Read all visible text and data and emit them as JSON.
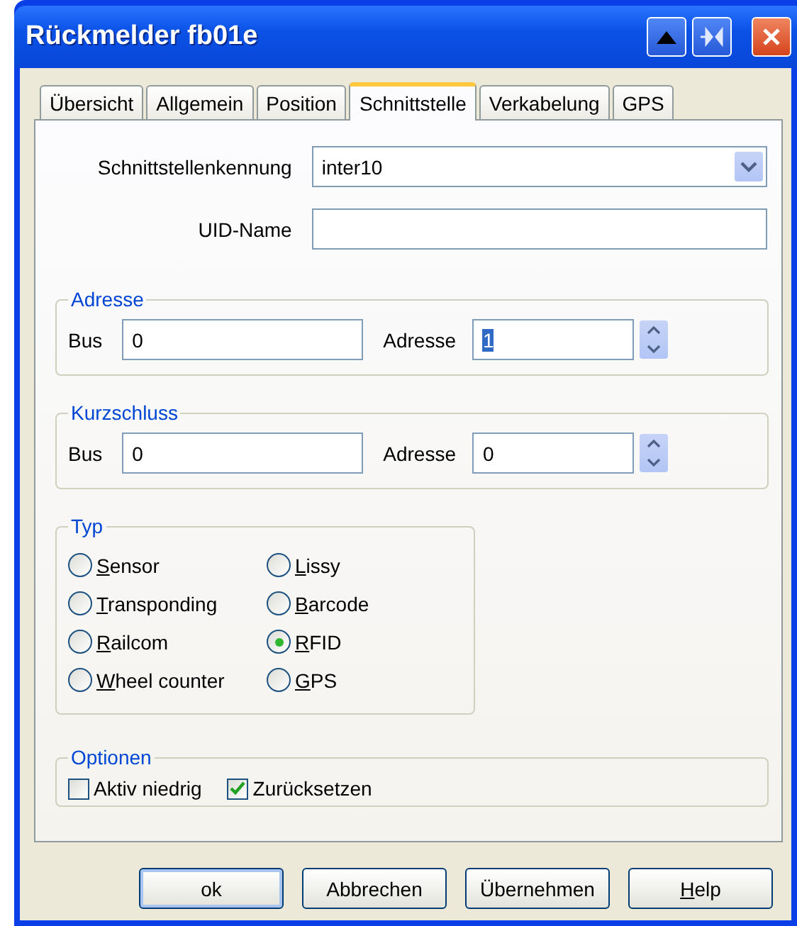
{
  "window": {
    "title": "Rückmelder fb01e"
  },
  "tabs": [
    {
      "label": "Übersicht",
      "selected": false
    },
    {
      "label": "Allgemein",
      "selected": false
    },
    {
      "label": "Position",
      "selected": false
    },
    {
      "label": "Schnittstelle",
      "selected": true
    },
    {
      "label": "Verkabelung",
      "selected": false
    },
    {
      "label": "GPS",
      "selected": false
    }
  ],
  "interface": {
    "label": "Schnittstellenkennung",
    "value": "inter10"
  },
  "uid_name": {
    "label": "UID-Name"
  },
  "address_group": {
    "title": "Adresse",
    "bus_label": "Bus",
    "bus_value": "0",
    "address_label": "Adresse",
    "address_value": "1",
    "address_selected": true
  },
  "short_circuit_group": {
    "title": "Kurzschluss",
    "bus_label": "Bus",
    "bus_value": "0",
    "address_label": "Adresse",
    "address_value": "0",
    "address_selected": false
  },
  "type_group": {
    "title": "Typ",
    "options": [
      {
        "label": "Sensor",
        "selected": false
      },
      {
        "label": "Transponding",
        "selected": false
      },
      {
        "label": "Railcom",
        "selected": false
      },
      {
        "label": "Wheel counter",
        "selected": false
      },
      {
        "label": "Lissy",
        "selected": false
      },
      {
        "label": "Barcode",
        "selected": false
      },
      {
        "label": "RFID",
        "selected": true
      },
      {
        "label": "GPS",
        "selected": false
      }
    ]
  },
  "options_group": {
    "title": "Optionen",
    "items": [
      {
        "label": "Aktiv niedrig",
        "checked": false
      },
      {
        "label": "Zurücksetzen",
        "checked": true
      }
    ]
  },
  "buttons": [
    {
      "label": "ok",
      "default": true,
      "mnemonic": false
    },
    {
      "label": "Abbrechen",
      "default": false,
      "mnemonic": false
    },
    {
      "label": "Übernehmen",
      "default": false,
      "mnemonic": false
    },
    {
      "label": "Help",
      "default": false,
      "mnemonic": true
    }
  ]
}
